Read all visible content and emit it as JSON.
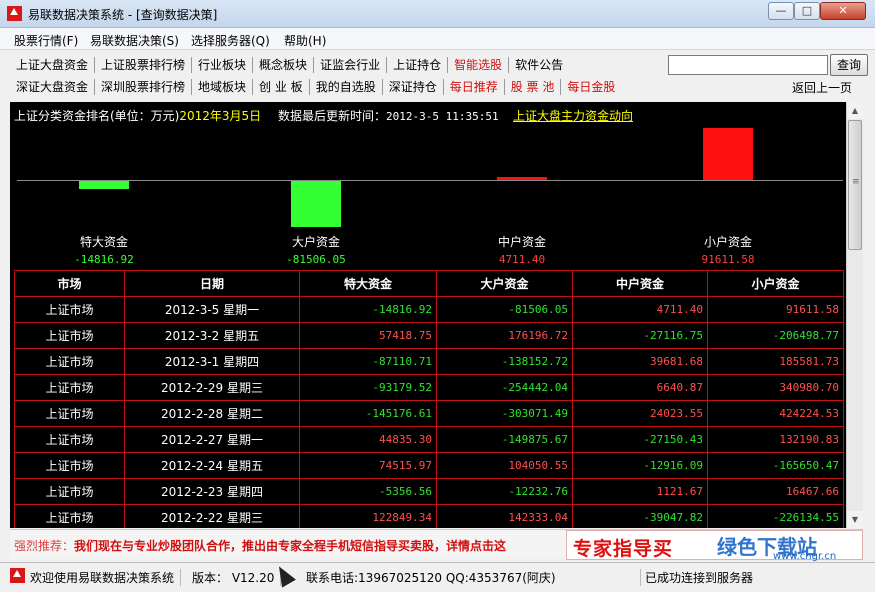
{
  "window": {
    "title": "易联数据决策系统 - [查询数据决策]",
    "minimize_glyph": "—",
    "maximize_glyph": "□",
    "close_glyph": "✕"
  },
  "menu": {
    "items": [
      "股票行情(F)",
      "易联数据决策(S)",
      "选择服务器(Q)",
      "帮助(H)"
    ]
  },
  "nav": {
    "row1": [
      {
        "label": "上证大盘资金",
        "red": false
      },
      {
        "label": "上证股票排行榜",
        "red": false
      },
      {
        "label": "行业板块",
        "red": false
      },
      {
        "label": "概念板块",
        "red": false
      },
      {
        "label": "证监会行业",
        "red": false
      },
      {
        "label": "上证持仓",
        "red": false
      },
      {
        "label": "智能选股",
        "red": true
      },
      {
        "label": "软件公告",
        "red": false
      }
    ],
    "row2": [
      {
        "label": "深证大盘资金",
        "red": false
      },
      {
        "label": "深圳股票排行榜",
        "red": false
      },
      {
        "label": "地域板块",
        "red": false
      },
      {
        "label": "创 业 板",
        "red": false
      },
      {
        "label": "我的自选股",
        "red": false
      },
      {
        "label": "深证持仓",
        "red": false
      },
      {
        "label": "每日推荐",
        "red": true
      },
      {
        "label": "股 票 池",
        "red": true
      },
      {
        "label": "每日金股",
        "red": true
      }
    ],
    "search_value": "",
    "search_button": "查询",
    "back_link": "返回上一页"
  },
  "panel": {
    "heading": "上证分类资金排名(单位：万元)",
    "heading_date": "2012年3月5日",
    "update_label": "数据最后更新时间：",
    "update_time": "2012-3-5 11:35:51",
    "link": "上证大盘主力资金动向",
    "colors": {
      "positive": "#ff1010",
      "negative": "#33ff33"
    }
  },
  "chart_data": {
    "type": "bar",
    "categories": [
      "特大资金",
      "大户资金",
      "中户资金",
      "小户资金"
    ],
    "values": [
      -14816.92,
      -81506.05,
      4711.4,
      91611.58
    ],
    "value_labels": [
      "-14816.92",
      "-81506.05",
      "4711.40",
      "91611.58"
    ]
  },
  "table": {
    "headers": [
      "市场",
      "日期",
      "特大资金",
      "大户资金",
      "中户资金",
      "小户资金"
    ],
    "rows": [
      [
        "上证市场",
        "2012-3-5 星期一",
        "-14816.92",
        "-81506.05",
        "4711.40",
        "91611.58"
      ],
      [
        "上证市场",
        "2012-3-2 星期五",
        "57418.75",
        "176196.72",
        "-27116.75",
        "-206498.77"
      ],
      [
        "上证市场",
        "2012-3-1 星期四",
        "-87110.71",
        "-138152.72",
        "39681.68",
        "185581.73"
      ],
      [
        "上证市场",
        "2012-2-29 星期三",
        "-93179.52",
        "-254442.04",
        "6640.87",
        "340980.70"
      ],
      [
        "上证市场",
        "2012-2-28 星期二",
        "-145176.61",
        "-303071.49",
        "24023.55",
        "424224.53"
      ],
      [
        "上证市场",
        "2012-2-27 星期一",
        "44835.30",
        "-149875.67",
        "-27150.43",
        "132190.83"
      ],
      [
        "上证市场",
        "2012-2-24 星期五",
        "74515.97",
        "104050.55",
        "-12916.09",
        "-165650.47"
      ],
      [
        "上证市场",
        "2012-2-23 星期四",
        "-5356.56",
        "-12232.76",
        "1121.67",
        "16467.66"
      ],
      [
        "上证市场",
        "2012-2-22 星期三",
        "122849.34",
        "142333.04",
        "-39047.82",
        "-226134.55"
      ]
    ]
  },
  "ad": {
    "prefix": "强烈推荐：",
    "text": "我们现在与专业炒股团队合作，推出由专家全程手机短信指导买卖股，详情点击这",
    "banner": "专家指导买",
    "watermark": "绿色下载站",
    "watermark_sub": "www.cngr.cn"
  },
  "status": {
    "welcome": "欢迎使用易联数据决策系统",
    "version": "版本： V12.20",
    "contact": "联系电话:13967025120 QQ:4353767(阿庆)",
    "connection": "已成功连接到服务器"
  }
}
